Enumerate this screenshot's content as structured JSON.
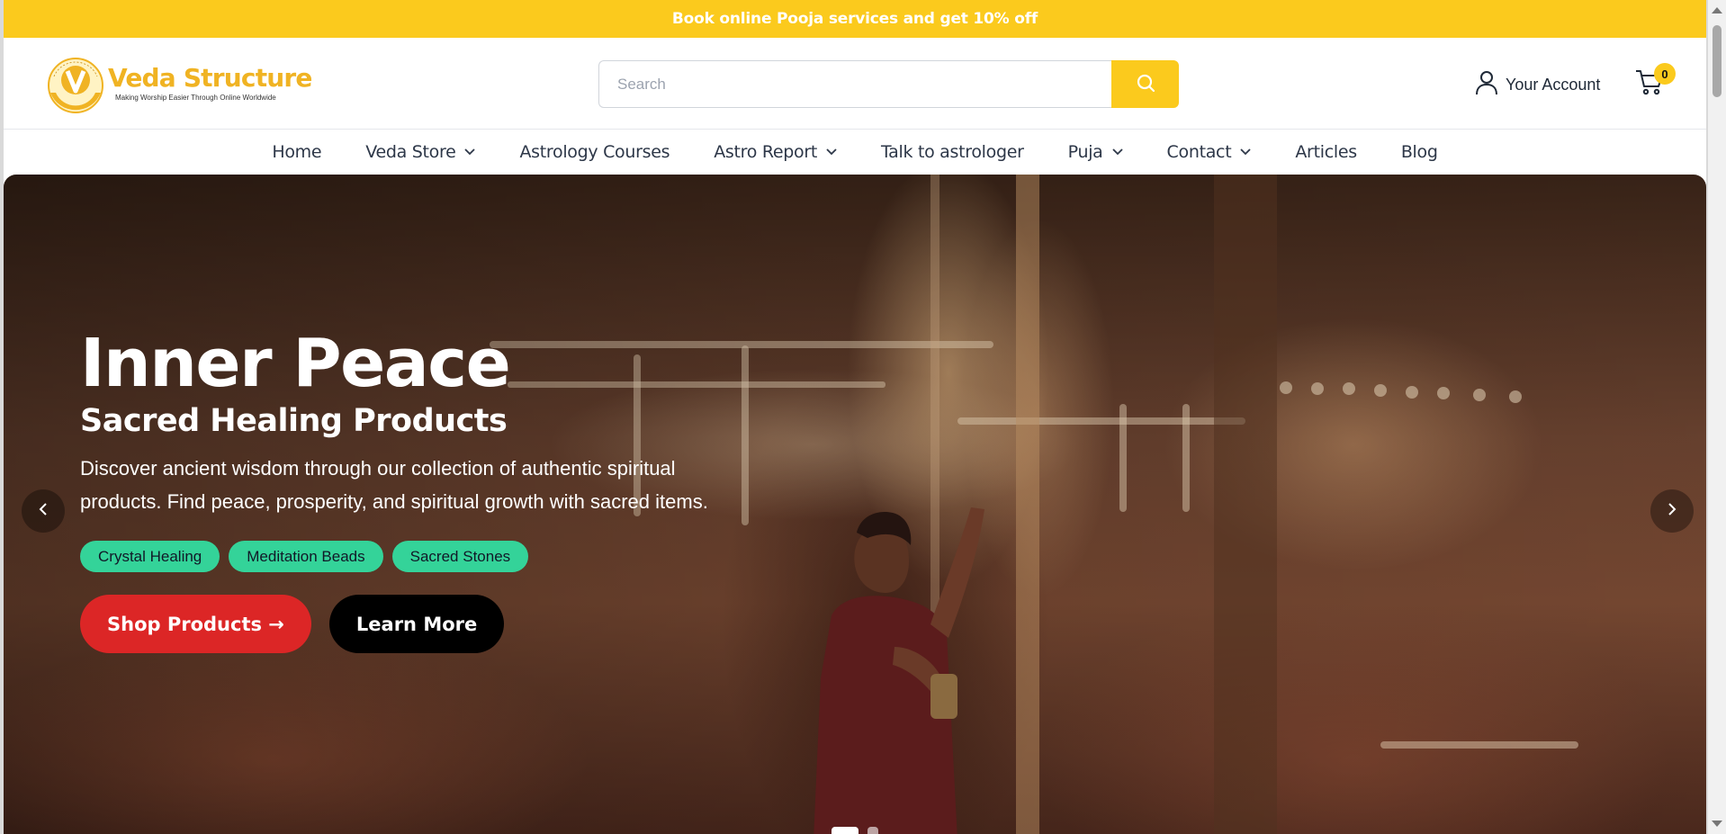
{
  "promo": {
    "text": "Book online Pooja services and get 10% off"
  },
  "brand": {
    "name": "Veda Structure",
    "tagline": "Making Worship Easier Through Online Worldwide",
    "seal_text": "VEDA STRUCTURE",
    "primary_color": "#fbca1d"
  },
  "search": {
    "placeholder": "Search",
    "value": ""
  },
  "account": {
    "label": "Your Account"
  },
  "cart": {
    "count": "0"
  },
  "nav": {
    "items": [
      {
        "label": "Home",
        "dropdown": false
      },
      {
        "label": "Veda Store",
        "dropdown": true
      },
      {
        "label": "Astrology Courses",
        "dropdown": false
      },
      {
        "label": "Astro Report",
        "dropdown": true
      },
      {
        "label": "Talk to astrologer",
        "dropdown": false
      },
      {
        "label": "Puja",
        "dropdown": true
      },
      {
        "label": "Contact",
        "dropdown": true
      },
      {
        "label": "Articles",
        "dropdown": false
      },
      {
        "label": "Blog",
        "dropdown": false
      }
    ]
  },
  "hero": {
    "title": "Inner Peace",
    "subtitle": "Sacred Healing Products",
    "description": "Discover ancient wisdom through our collection of authentic spiritual products. Find peace, prosperity, and spiritual growth with sacred items.",
    "tags": [
      "Crystal Healing",
      "Meditation Beads",
      "Sacred Stones"
    ],
    "primary_cta": "Shop Products →",
    "secondary_cta": "Learn More",
    "slides": 2,
    "active_slide": 1,
    "colors": {
      "tag": "#34d399",
      "primary_cta": "#dc2626",
      "secondary_cta": "#000000"
    }
  }
}
